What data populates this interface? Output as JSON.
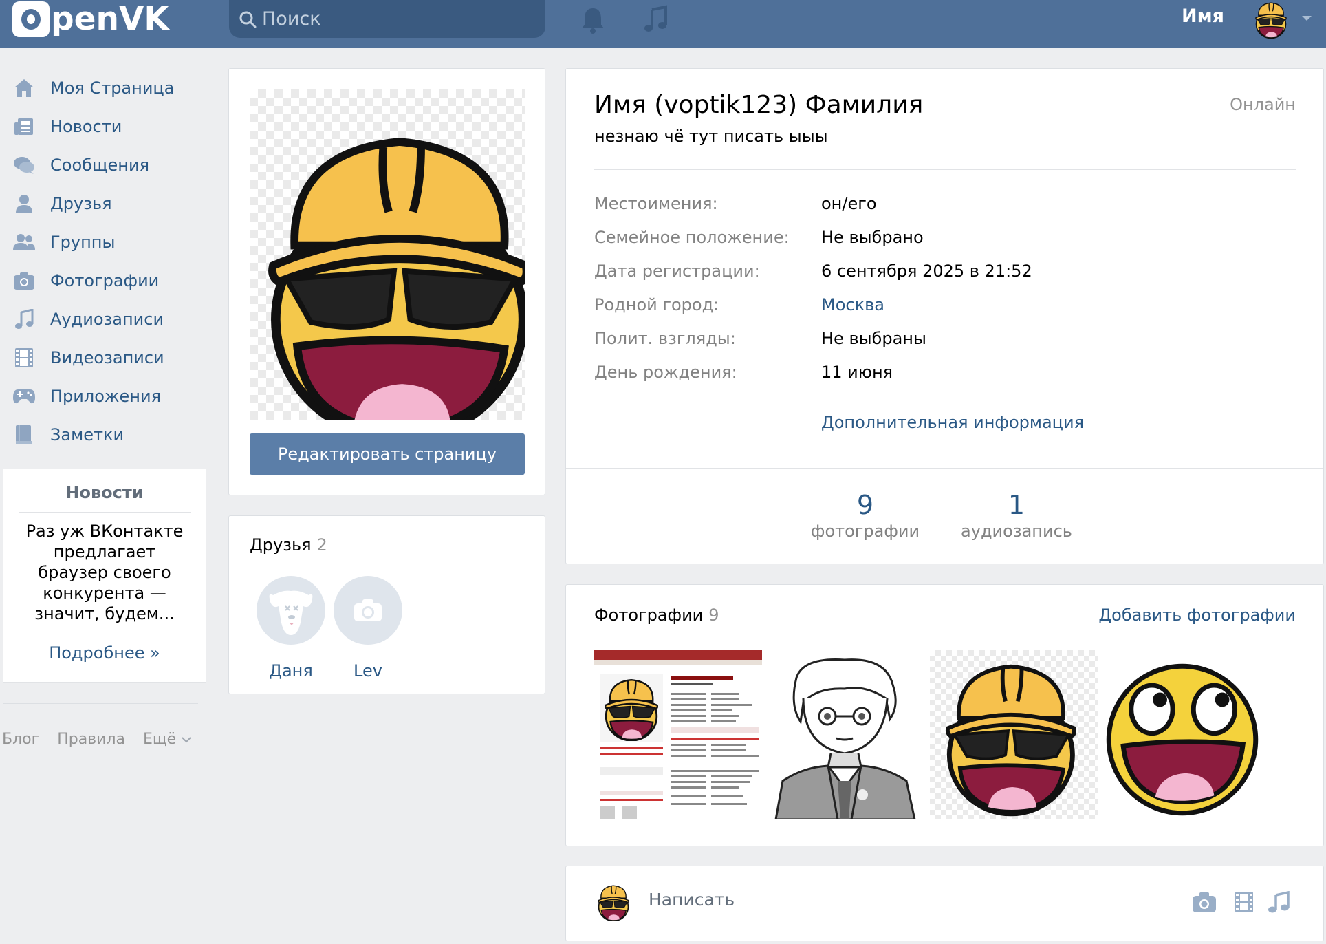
{
  "header": {
    "logo_text": "penVK",
    "search_placeholder": "Поиск",
    "user_name": "Имя",
    "brand_color": "#4f7099",
    "icons": [
      "bell-icon",
      "music-note-icon",
      "search-icon",
      "caret-down-icon"
    ]
  },
  "sidebar": {
    "items": [
      {
        "label": "Моя Страница",
        "icon": "home-icon"
      },
      {
        "label": "Новости",
        "icon": "newspaper-icon"
      },
      {
        "label": "Сообщения",
        "icon": "chat-bubbles-icon"
      },
      {
        "label": "Друзья",
        "icon": "person-icon"
      },
      {
        "label": "Группы",
        "icon": "people-icon"
      },
      {
        "label": "Фотографии",
        "icon": "camera-icon"
      },
      {
        "label": "Аудиозаписи",
        "icon": "music-note-icon"
      },
      {
        "label": "Видеозаписи",
        "icon": "film-icon"
      },
      {
        "label": "Приложения",
        "icon": "gamepad-icon"
      },
      {
        "label": "Заметки",
        "icon": "notebook-icon"
      }
    ],
    "news": {
      "title": "Новости",
      "text": "Раз уж ВКонтакте предлагает браузер своего конкурента — значит, будем...",
      "more": "Подробнее »"
    },
    "footer": {
      "blog": "Блог",
      "rules": "Правила",
      "more": "Ещё"
    }
  },
  "profile": {
    "edit_button": "Редактировать страницу",
    "name": "Имя (voptik123) Фамилия",
    "status": "незнаю чё тут писать ыыы",
    "online": "Онлайн",
    "info": [
      {
        "key": "Местоимения:",
        "value": "он/его",
        "link": false
      },
      {
        "key": "Семейное положение:",
        "value": "Не выбрано",
        "link": false
      },
      {
        "key": "Дата регистрации:",
        "value": "6 сентября 2025 в 21:52",
        "link": false
      },
      {
        "key": "Родной город:",
        "value": "Москва",
        "link": true
      },
      {
        "key": "Полит. взгляды:",
        "value": "Не выбраны",
        "link": false
      },
      {
        "key": "День рождения:",
        "value": "11 июня",
        "link": false
      }
    ],
    "more_info": "Дополнительная информация",
    "counters": [
      {
        "num": "9",
        "label": "фотографии"
      },
      {
        "num": "1",
        "label": "аудиозапись"
      }
    ]
  },
  "friends": {
    "title": "Друзья",
    "count": "2",
    "list": [
      {
        "name": "Даня",
        "avatar": "dog-default-avatar"
      },
      {
        "name": "Lev",
        "avatar": "camera-placeholder-avatar"
      }
    ]
  },
  "photos": {
    "title": "Фотографии",
    "count": "9",
    "add_label": "Добавить фотографии",
    "items": [
      "profile-screenshot",
      "anime-character-drawing",
      "hardhat-smiley",
      "awesome-face"
    ]
  },
  "composer": {
    "placeholder": "Написать",
    "icons": [
      "camera-icon",
      "film-icon",
      "music-note-icon"
    ]
  }
}
